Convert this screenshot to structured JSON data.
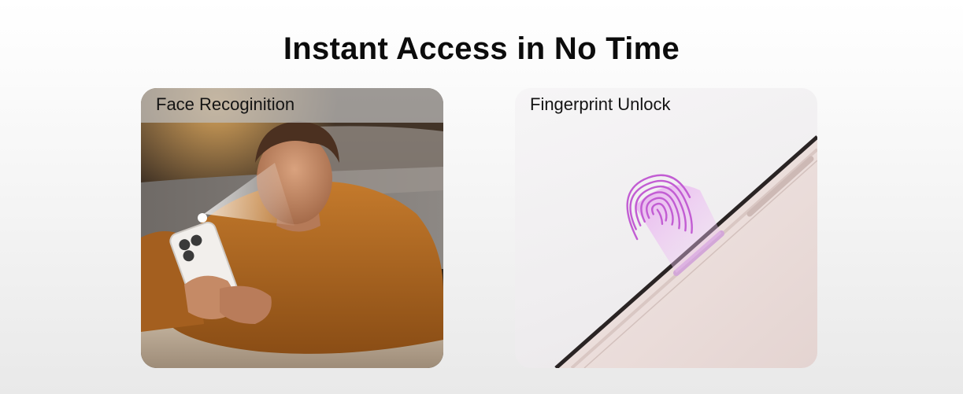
{
  "headline": "Instant Access in No Time",
  "features": [
    {
      "label": "Face Recoginition",
      "image": "person-unlocking-phone-with-face-scan"
    },
    {
      "label": "Fingerprint Unlock",
      "image": "fingerprint-side-button-unlock"
    }
  ],
  "colors": {
    "sweater": "#b06a22",
    "fingerprint": "#c86ad6",
    "phone_frame": "#e8d8d6"
  }
}
